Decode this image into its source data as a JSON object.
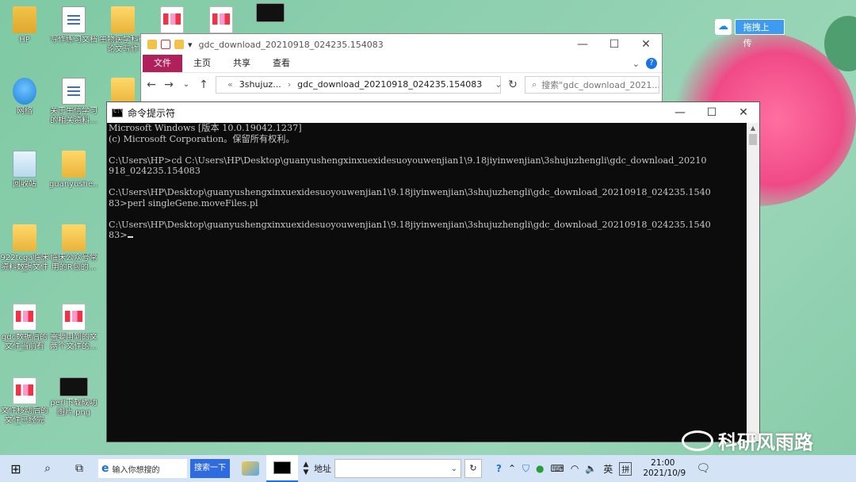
{
  "desktop": {
    "icons": [
      {
        "label": "HP",
        "kind": "user"
      },
      {
        "label": "写作练习文档",
        "kind": "doc"
      },
      {
        "label": "生物医学科研论文写作",
        "kind": "folder"
      },
      {
        "label": "",
        "kind": "pic"
      },
      {
        "label": "",
        "kind": "pic"
      },
      {
        "label": "",
        "kind": "shot"
      },
      {
        "label": "网络",
        "kind": "net"
      },
      {
        "label": "关于生信学习的相关资料...",
        "kind": "doc"
      },
      {
        "label": "",
        "kind": "folder"
      },
      {
        "label": "回收站",
        "kind": "bin"
      },
      {
        "label": "guanyushe...",
        "kind": "folder"
      },
      {
        "label": "922tcga临床资料数据文件夹",
        "kind": "folder"
      },
      {
        "label": "临床公众号常用的R包的...",
        "kind": "folder"
      },
      {
        "label": "gdc数据后的文件当前有文...",
        "kind": "pic"
      },
      {
        "label": "需要用到的文两个文件的...",
        "kind": "pic"
      },
      {
        "label": "文件移动后的文件已经完成.p...",
        "kind": "pic"
      },
      {
        "label": "perl下载成功图片.png",
        "kind": "shot"
      }
    ]
  },
  "upload": {
    "label": "拖拽上传"
  },
  "explorer": {
    "title": "gdc_download_20210918_024235.154083",
    "tabs": [
      "文件",
      "主页",
      "共享",
      "查看"
    ],
    "path": [
      "3shujuz...",
      "gdc_download_20210918_024235.154083"
    ],
    "search_placeholder": "搜索\"gdc_download_2021...",
    "controls": {
      "minimize": "—",
      "maximize": "☐",
      "close": "✕"
    }
  },
  "cmd": {
    "title": "命令提示符",
    "lines": [
      "Microsoft Windows [版本 10.0.19042.1237]",
      "(c) Microsoft Corporation。保留所有权利。",
      "",
      "C:\\Users\\HP>cd C:\\Users\\HP\\Desktop\\guanyushengxinxuexidesuoyouwenjian1\\9.18jiyinwenjian\\3shujuzhengli\\gdc_download_20210",
      "918_024235.154083",
      "",
      "C:\\Users\\HP\\Desktop\\guanyushengxinxuexidesuoyouwenjian1\\9.18jiyinwenjian\\3shujuzhengli\\gdc_download_20210918_024235.1540",
      "83>perl singleGene.moveFiles.pl",
      "",
      "C:\\Users\\HP\\Desktop\\guanyushengxinxuexidesuoyouwenjian1\\9.18jiyinwenjian\\3shujuzhengli\\gdc_download_20210918_024235.1540",
      "83>"
    ],
    "controls": {
      "minimize": "—",
      "maximize": "☐",
      "close": "✕"
    }
  },
  "watermark": {
    "text": "科研风雨路"
  },
  "taskbar": {
    "search_placeholder": "输入你想搜的",
    "baidu_button": "搜索一下",
    "address_label": "地址",
    "clock_time": "21:00",
    "clock_date": "2021/10/9",
    "ime_lang": "英",
    "ime_mode": "拼"
  }
}
